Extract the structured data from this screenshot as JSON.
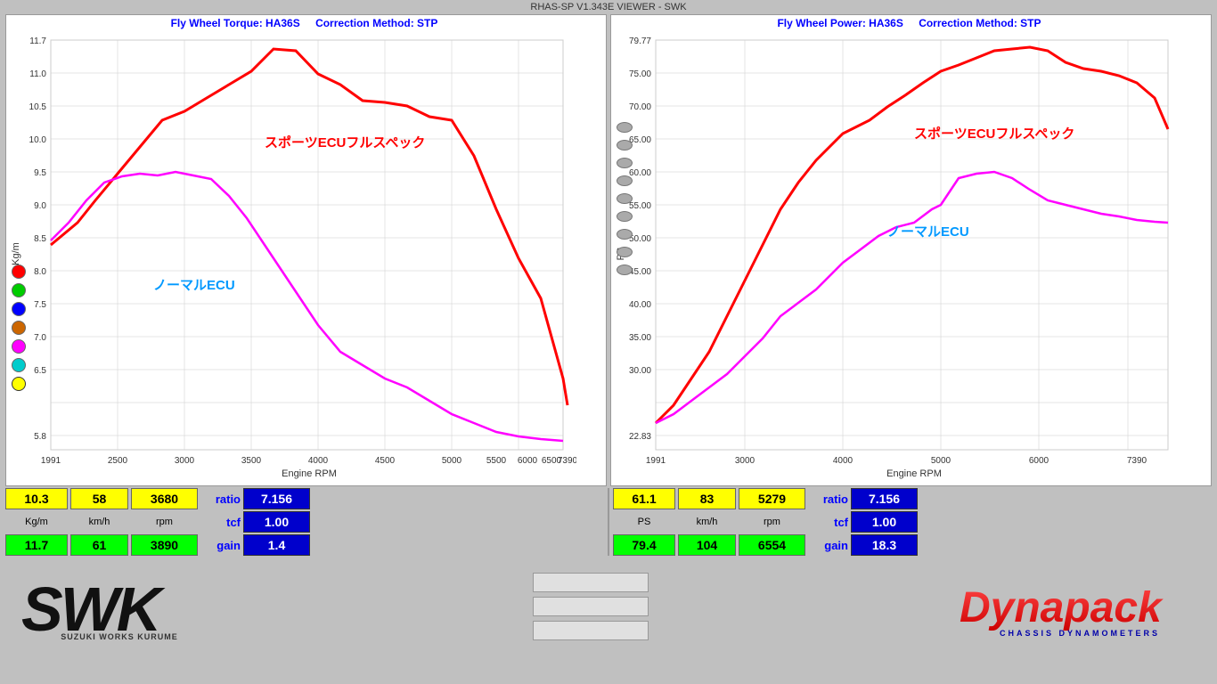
{
  "title": "RHAS-SP V1.343E VIEWER - SWK",
  "left_chart": {
    "title": "Fly Wheel Torque: HA36S",
    "correction": "Correction Method: STP",
    "y_label": "Kg/m",
    "x_label": "Engine RPM",
    "y_max": "11.7",
    "y_min": "5.8",
    "y_ticks": [
      "11.7",
      "11.0",
      "10.5",
      "10.0",
      "9.5",
      "9.0",
      "8.5",
      "8.0",
      "7.5",
      "7.0",
      "6.5",
      "5.8"
    ],
    "x_ticks": [
      "1991",
      "2500",
      "3000",
      "3500",
      "4000",
      "4500",
      "5000",
      "5500",
      "6000",
      "6500",
      "7390"
    ],
    "series1_label": "スポーツECUフルスペック",
    "series2_label": "ノーマルECU"
  },
  "right_chart": {
    "title": "Fly Wheel Power: HA36S",
    "correction": "Correction Method: STP",
    "y_label": "PS",
    "x_label": "Engine RPM",
    "y_max": "79.77",
    "y_min": "22.83",
    "y_ticks": [
      "79.77",
      "75.00",
      "70.00",
      "65.00",
      "60.00",
      "55.00",
      "50.00",
      "45.00",
      "40.00",
      "35.00",
      "30.00",
      "22.83"
    ],
    "x_ticks": [
      "1991",
      "3000",
      "4000",
      "5000",
      "6000",
      "7390"
    ],
    "series1_label": "スポーツECUフルスペック",
    "series2_label": "ノーマルECU"
  },
  "legend": {
    "colors": [
      "#ff0000",
      "#00cc00",
      "#0000ff",
      "#cc6600",
      "#ff00ff",
      "#00cccc",
      "#ffff00"
    ]
  },
  "left_stats": {
    "val1": "10.3",
    "val2": "58",
    "val3": "3680",
    "ratio_label": "ratio",
    "ratio_val": "7.156",
    "unit1": "Kg/m",
    "unit2": "km/h",
    "unit3": "rpm",
    "tcf_label": "tcf",
    "tcf_val": "1.00",
    "green1": "11.7",
    "green2": "61",
    "green3": "3890",
    "gain_label": "gain",
    "gain_val": "1.4"
  },
  "right_stats": {
    "val1": "61.1",
    "val2": "83",
    "val3": "5279",
    "ratio_label": "ratio",
    "ratio_val": "7.156",
    "unit1": "PS",
    "unit2": "km/h",
    "unit3": "rpm",
    "tcf_label": "tcf",
    "tcf_val": "1.00",
    "green1": "79.4",
    "green2": "104",
    "green3": "6554",
    "gain_label": "gain",
    "gain_val": "18.3"
  },
  "bottom": {
    "swk_logo": "SWK",
    "swk_sub": "SUZUKI WORKS KURUME",
    "dynapack_logo": "Dynapack",
    "dynapack_sub": "CHASSIS  DYNAMOMETERS"
  }
}
